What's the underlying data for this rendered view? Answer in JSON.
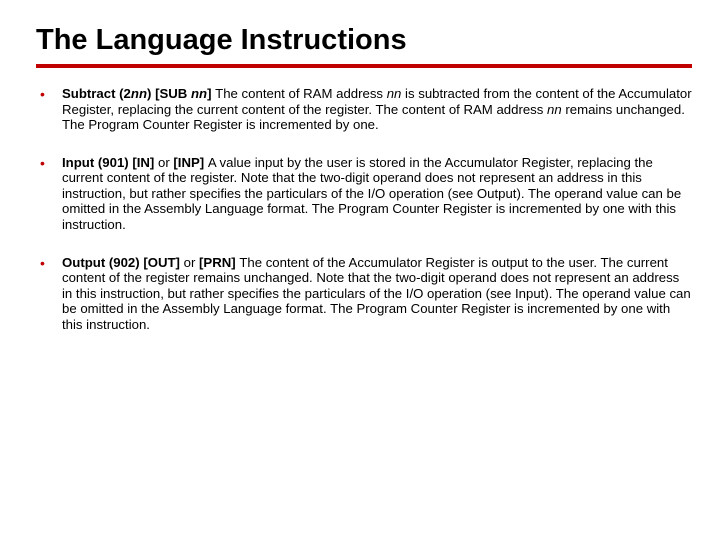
{
  "title": "The Language Instructions",
  "items": [
    {
      "lead_b": "Subtract (2",
      "lead_bi1": "nn",
      "mid_b1": ") [SUB ",
      "lead_bi2": "nn",
      "mid_b2": "] ",
      "t1": "The content of RAM address ",
      "i1": "nn",
      "t2": " is subtracted from the content of  the Accumulator Register, replacing the current content of the register. The content of RAM address ",
      "i2": "nn",
      "t3": " remains unchanged. The Program Counter Register is incremented by one."
    },
    {
      "lead_b": "Input (901) [IN] ",
      "mid_t": "or",
      "mid_b": " [INP] ",
      "body": "A value input by the user is stored in the Accumulator Register, replacing the current content of the register. Note that the two-digit operand does not represent an address in this instruction, but rather specifies the particulars of the I/O operation (see Output). The operand value can be omitted in the Assembly Language format. The Program Counter Register is incremented by one with this instruction."
    },
    {
      "lead_b": "Output (902) [OUT] ",
      "mid_t": "or",
      "mid_b": " [PRN] ",
      "body": "The content of  the Accumulator Register is output to the user. The current content of the register remains unchanged. Note that the two-digit operand does not represent an address in this instruction, but rather specifies the particulars of the I/O operation (see Input). The operand value can be omitted in the Assembly Language format. The Program Counter Register is incremented by one with this instruction."
    }
  ]
}
